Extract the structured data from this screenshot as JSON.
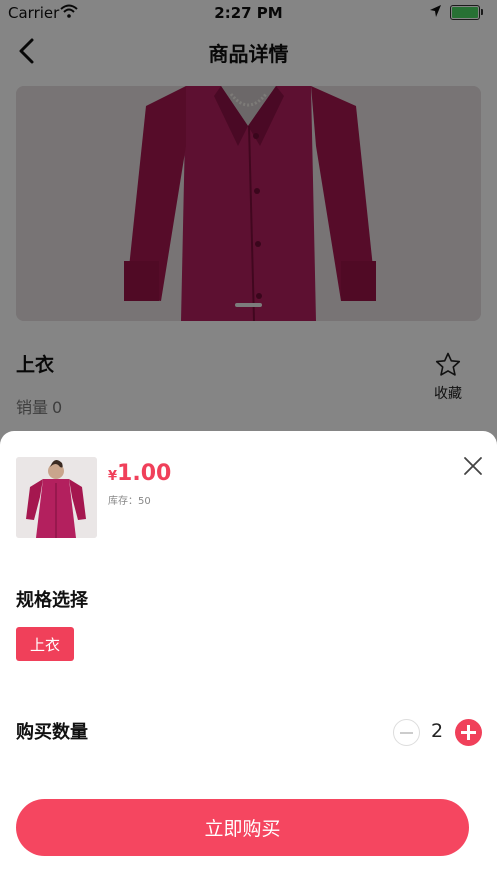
{
  "status_bar": {
    "carrier": "Carrier",
    "time": "2:27 PM",
    "battery_level": 1.0
  },
  "nav": {
    "title": "商品详情",
    "back_icon": "chevron-left-icon"
  },
  "product": {
    "image": "magenta-shirt-photo",
    "name": "上衣",
    "sales_label": "销量",
    "sales_count": "0",
    "favorite_label": "收藏",
    "favorite_icon": "star-outline-icon"
  },
  "sheet": {
    "currency_symbol": "¥",
    "price": "1.00",
    "stock_text": "库存：50",
    "close_icon": "close-icon",
    "spec_title": "规格选择",
    "spec_options": [
      "上衣"
    ],
    "quantity_title": "购买数量",
    "quantity": "2",
    "buy_label": "立即购买"
  },
  "colors": {
    "accent": "#f0405a",
    "overlay": "rgba(0,0,0,0.48)"
  }
}
